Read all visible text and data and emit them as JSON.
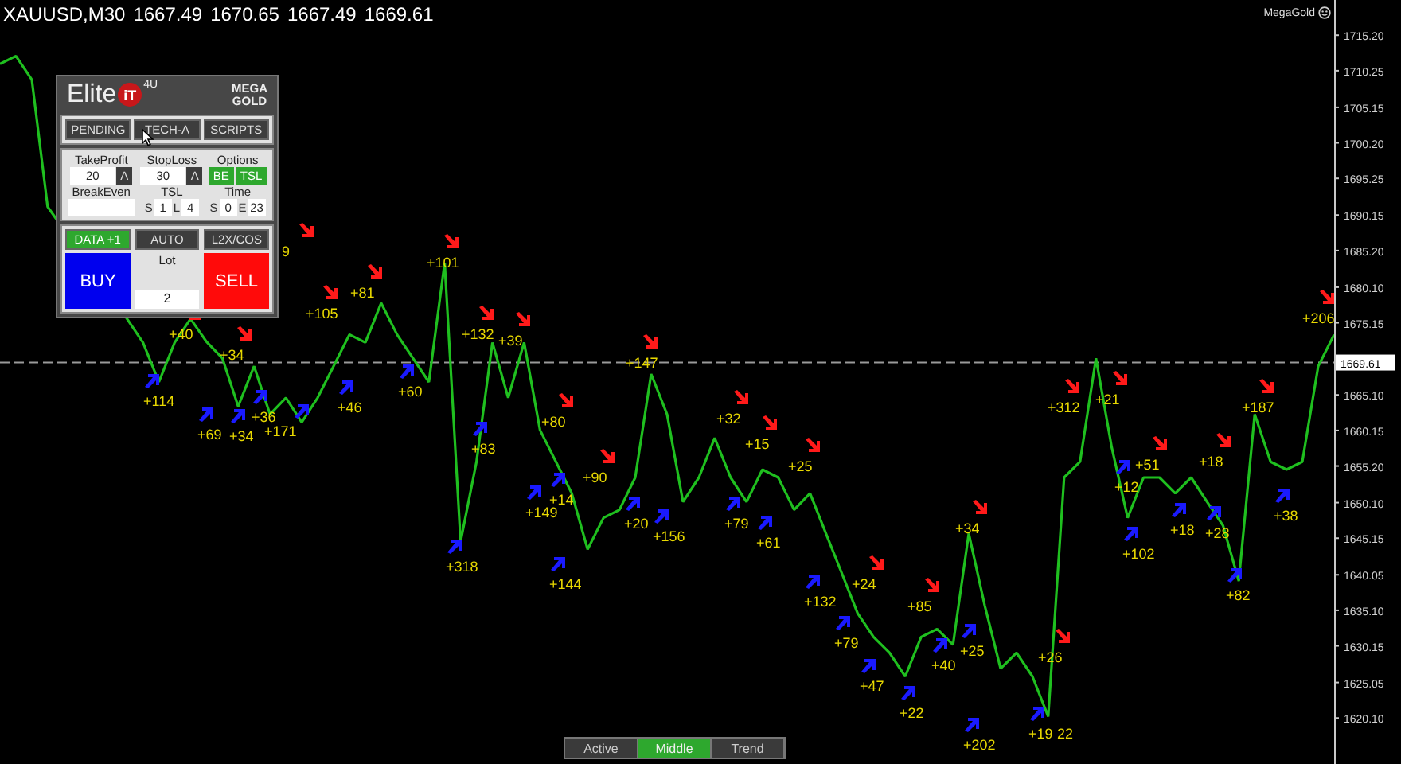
{
  "header": {
    "symbol": "XAUUSD,M30",
    "ohlc": [
      "1667.49",
      "1670.65",
      "1667.49",
      "1669.61"
    ]
  },
  "brand": {
    "label": "MegaGold"
  },
  "chart": {
    "chart_data": {
      "type": "line",
      "ylim": [
        1613.7,
        1720.1
      ],
      "categories": [
        null,
        null,
        null,
        null,
        null,
        null,
        null,
        null,
        null,
        null,
        null,
        null,
        null,
        null,
        null,
        null,
        null,
        null,
        null,
        null,
        null,
        null,
        null,
        null,
        null,
        null,
        null,
        null,
        null,
        null,
        null,
        null,
        null,
        null,
        null,
        null,
        null,
        null,
        null,
        null,
        null,
        null,
        null,
        null,
        null,
        null,
        null,
        null,
        null,
        null,
        null,
        null,
        null,
        null,
        null,
        null,
        null,
        null,
        null,
        null,
        null,
        null,
        null,
        null,
        null,
        null,
        null,
        null,
        null,
        null,
        null,
        null,
        null,
        null,
        null,
        null,
        null,
        null,
        null,
        null,
        null,
        null,
        null,
        null,
        null
      ],
      "series": [
        {
          "color": "#1fbf1f",
          "values": [
            1711.2,
            1712.3,
            1709.0,
            1691.3,
            null,
            null,
            null,
            null,
            1675.7,
            1672.4,
            1666.9,
            1672.4,
            1675.7,
            1672.5,
            1670.2,
            1663.5,
            1669.1,
            1662.4,
            1664.7,
            1661.3,
            1664.7,
            1669.1,
            1673.5,
            1672.4,
            1677.9,
            1673.5,
            1670.2,
            1666.9,
            1683.5,
            1644.7,
            1655.8,
            1672.4,
            1664.7,
            1672.4,
            1660.2,
            1655.8,
            1651.4,
            1643.6,
            1648.0,
            1649.1,
            1653.6,
            1668.0,
            1662.4,
            1650.2,
            1653.6,
            1659.1,
            1653.6,
            1650.2,
            1654.7,
            1653.6,
            1649.1,
            1651.4,
            1645.8,
            1640.3,
            1634.7,
            1631.4,
            1629.2,
            1625.9,
            1631.4,
            1632.5,
            1630.3,
            1645.8,
            1635.8,
            1627.0,
            1629.2,
            1625.9,
            1620.3,
            1653.6,
            1655.8,
            1670.2,
            1657.8,
            1648.0,
            1653.6,
            1653.6,
            1651.4,
            1653.6,
            1650.2,
            1646.9,
            1639.2,
            1662.4,
            1655.8,
            1654.7,
            1655.8,
            1669.1,
            1673.5
          ]
        }
      ],
      "yticks": [
        {
          "value": 1715.2,
          "label": "1715.20"
        },
        {
          "value": 1710.25,
          "label": "1710.25"
        },
        {
          "value": 1705.15,
          "label": "1705.15"
        },
        {
          "value": 1700.2,
          "label": "1700.20"
        },
        {
          "value": 1695.25,
          "label": "1695.25"
        },
        {
          "value": 1690.15,
          "label": "1690.15"
        },
        {
          "value": 1685.2,
          "label": "1685.20"
        },
        {
          "value": 1680.1,
          "label": "1680.10"
        },
        {
          "value": 1675.15,
          "label": "1675.15"
        },
        {
          "value": 1665.1,
          "label": "1665.10"
        },
        {
          "value": 1660.15,
          "label": "1660.15"
        },
        {
          "value": 1655.2,
          "label": "1655.20"
        },
        {
          "value": 1650.1,
          "label": "1650.10"
        },
        {
          "value": 1645.15,
          "label": "1645.15"
        },
        {
          "value": 1640.05,
          "label": "1640.05"
        },
        {
          "value": 1635.1,
          "label": "1635.10"
        },
        {
          "value": 1630.15,
          "label": "1630.15"
        },
        {
          "value": 1625.05,
          "label": "1625.05"
        },
        {
          "value": 1620.1,
          "label": "1620.10"
        }
      ],
      "ref_lines": [
        {
          "axis": "y",
          "value": 1669.61,
          "label": "1669.61"
        }
      ]
    },
    "signals": [
      {
        "kind": "buy",
        "text": "+114"
      },
      {
        "kind": "sell",
        "text": "+40"
      },
      {
        "kind": "sell",
        "text": "+34"
      },
      {
        "kind": "buy",
        "text": "+69"
      },
      {
        "kind": "buy",
        "text": "+34"
      },
      {
        "kind": "buy",
        "text": "+36"
      },
      {
        "kind": "buy",
        "text": "+171"
      },
      {
        "kind": "sell",
        "text": "9"
      },
      {
        "kind": "sell",
        "text": "+105"
      },
      {
        "kind": "buy",
        "text": "+46"
      },
      {
        "kind": "sell",
        "text": "+81"
      },
      {
        "kind": "buy",
        "text": "+60"
      },
      {
        "kind": "sell",
        "text": "+101"
      },
      {
        "kind": "sell",
        "text": "+132"
      },
      {
        "kind": "sell",
        "text": "+39"
      },
      {
        "kind": "buy",
        "text": "+83"
      },
      {
        "kind": "buy",
        "text": "+318"
      },
      {
        "kind": "sell",
        "text": "+80"
      },
      {
        "kind": "sell",
        "text": "+147"
      },
      {
        "kind": "buy",
        "text": "+149"
      },
      {
        "kind": "buy",
        "text": "+14"
      },
      {
        "kind": "sell",
        "text": "+90"
      },
      {
        "kind": "buy",
        "text": "+20"
      },
      {
        "kind": "buy",
        "text": "+144"
      },
      {
        "kind": "buy",
        "text": "+156"
      },
      {
        "kind": "sell",
        "text": "+32"
      },
      {
        "kind": "sell",
        "text": "+15"
      },
      {
        "kind": "buy",
        "text": "+79"
      },
      {
        "kind": "sell",
        "text": "+25"
      },
      {
        "kind": "buy",
        "text": "+61"
      },
      {
        "kind": "buy",
        "text": "+132"
      },
      {
        "kind": "sell",
        "text": "+24"
      },
      {
        "kind": "buy",
        "text": "+79"
      },
      {
        "kind": "sell",
        "text": "+85"
      },
      {
        "kind": "buy",
        "text": "+47"
      },
      {
        "kind": "buy",
        "text": "+22"
      },
      {
        "kind": "buy",
        "text": "+40"
      },
      {
        "kind": "sell",
        "text": "+34"
      },
      {
        "kind": "buy",
        "text": "+25"
      },
      {
        "kind": "buy",
        "text": "+202"
      },
      {
        "kind": "sell",
        "text": "+26"
      },
      {
        "kind": "buy",
        "text": "+19"
      },
      {
        "kind": "plain",
        "text": "22"
      },
      {
        "kind": "sell",
        "text": "+312"
      },
      {
        "kind": "sell",
        "text": "+21"
      },
      {
        "kind": "buy",
        "text": "+12"
      },
      {
        "kind": "buy",
        "text": "+102"
      },
      {
        "kind": "sell",
        "text": "+51"
      },
      {
        "kind": "buy",
        "text": "+18"
      },
      {
        "kind": "sell",
        "text": "+18"
      },
      {
        "kind": "buy",
        "text": "+28"
      },
      {
        "kind": "buy",
        "text": "+82"
      },
      {
        "kind": "sell",
        "text": "+187"
      },
      {
        "kind": "buy",
        "text": "+38"
      },
      {
        "kind": "sell",
        "text": "+206"
      }
    ]
  },
  "panel": {
    "logo_word": "Elite",
    "logo_mark": "iT",
    "logo_sup": "4U",
    "badge": [
      "MEGA",
      "GOLD"
    ],
    "menu": [
      {
        "label": "PENDING",
        "selected": false
      },
      {
        "label": "TECH-A",
        "selected": false
      },
      {
        "label": "SCRIPTS",
        "selected": false
      }
    ],
    "take_profit": {
      "label": "TakeProfit",
      "value": "20",
      "button": "A"
    },
    "stop_loss": {
      "label": "StopLoss",
      "value": "30",
      "button": "A"
    },
    "options": {
      "label": "Options",
      "toggles": [
        {
          "label": "BE",
          "on": true
        },
        {
          "label": "TSL",
          "on": true
        }
      ]
    },
    "break_even": {
      "label": "BreakEven"
    },
    "tsl": {
      "label": "TSL",
      "fields": [
        {
          "prefix": "S",
          "value": "1"
        },
        {
          "prefix": "L",
          "value": "4"
        }
      ]
    },
    "time": {
      "label": "Time",
      "fields": [
        {
          "prefix": "S",
          "value": "0"
        },
        {
          "prefix": "E",
          "value": "23"
        }
      ]
    },
    "modes": [
      {
        "label": "DATA +1",
        "on": true
      },
      {
        "label": "AUTO",
        "on": false
      },
      {
        "label": "L2X/COS",
        "on": false
      }
    ],
    "buy": "BUY",
    "lot": {
      "label": "Lot",
      "value": "2"
    },
    "sell": "SELL"
  },
  "bottom_tabs": [
    {
      "label": "Active",
      "selected": false
    },
    {
      "label": "Middle",
      "selected": true
    },
    {
      "label": "Trend",
      "selected": false
    }
  ]
}
